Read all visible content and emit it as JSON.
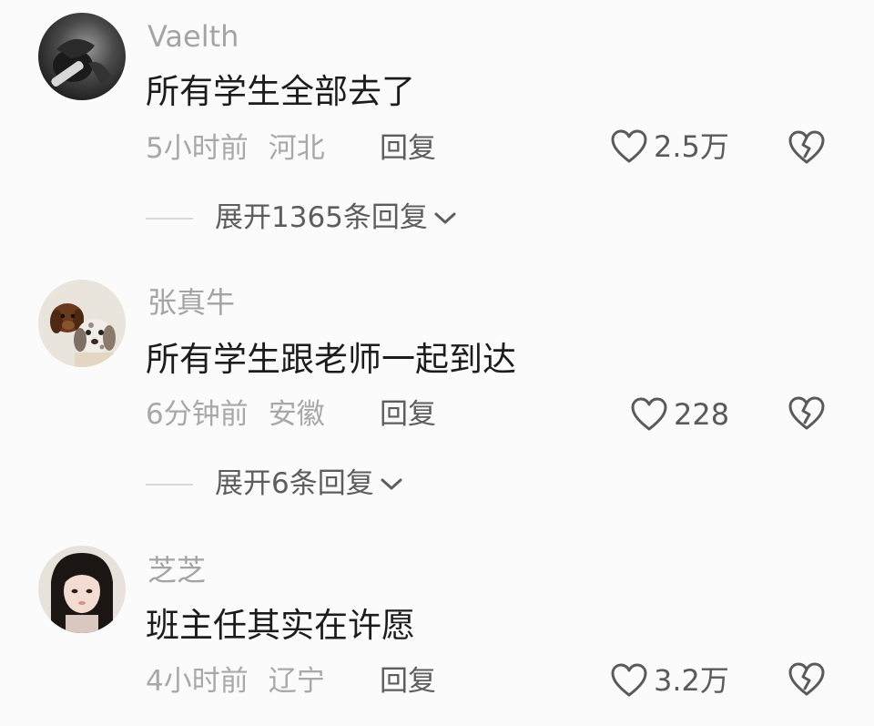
{
  "comments": [
    {
      "username": "Vaelth",
      "text": "所有学生全部去了",
      "time": "5小时前",
      "location": "河北",
      "reply_label": "回复",
      "likes": "2.5万",
      "avatar_icon": "dark-portrait-avatar",
      "expand_label": "展开1365条回复"
    },
    {
      "username": "张真牛",
      "text": "所有学生跟老师一起到达",
      "time": "6分钟前",
      "location": "安徽",
      "reply_label": "回复",
      "likes": "228",
      "avatar_icon": "puppies-avatar",
      "expand_label": "展开6条回复"
    },
    {
      "username": "芝芝",
      "text": "班主任其实在许愿",
      "time": "4小时前",
      "location": "辽宁",
      "reply_label": "回复",
      "likes": "3.2万",
      "avatar_icon": "girl-portrait-avatar"
    }
  ],
  "colors": {
    "background": "#fbfbfb",
    "text_primary": "#1c1c1c",
    "text_secondary": "#a8a8a8",
    "text_action": "#5d5d5d"
  }
}
